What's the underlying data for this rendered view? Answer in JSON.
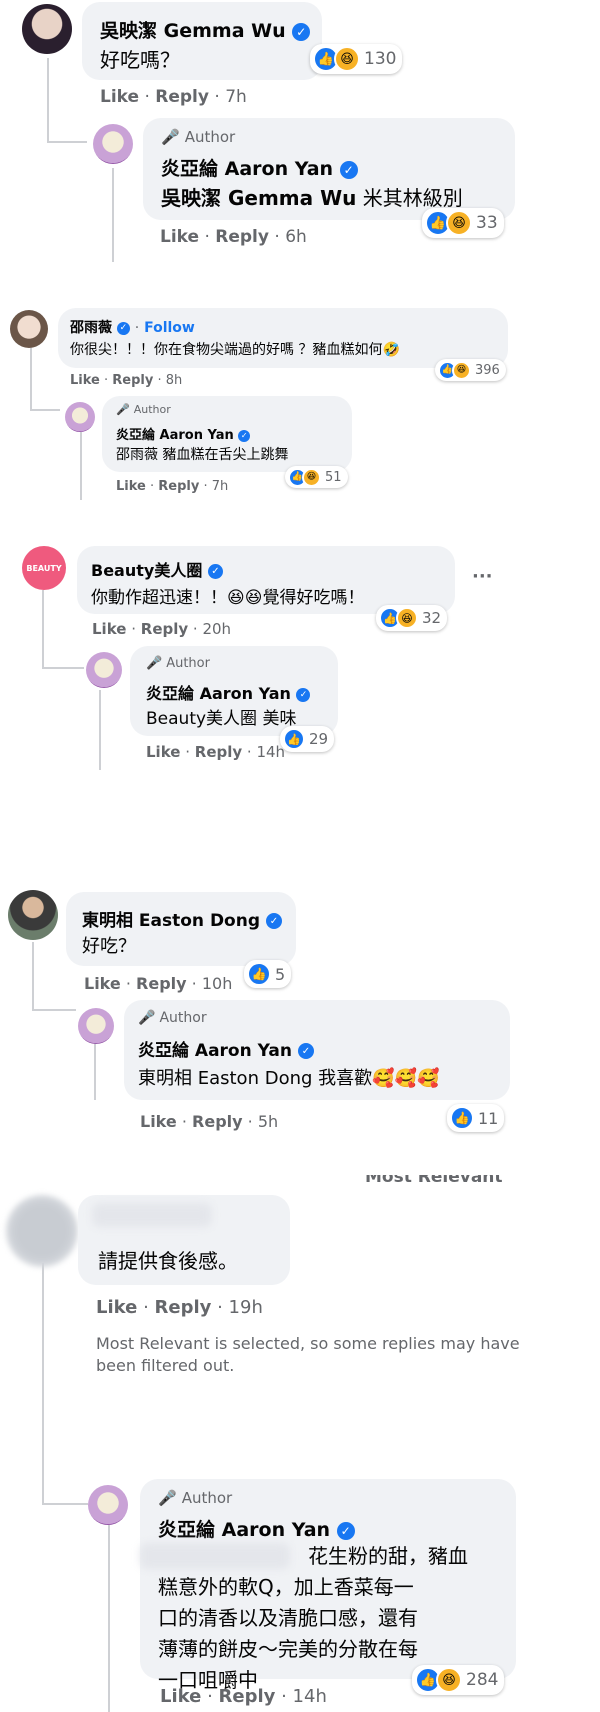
{
  "comments": [
    {
      "name": "吳映潔 Gemma Wu",
      "text": "好吃嗎？",
      "reaction_count": "130",
      "like_label": "Like",
      "reply_label": "Reply",
      "time": "7h",
      "reply": {
        "author_label": "Author",
        "name": "炎亞綸 Aaron Yan",
        "mention": "吳映潔 Gemma Wu",
        "text": "米其林級別",
        "reaction_count": "33",
        "like_label": "Like",
        "reply_label": "Reply",
        "time": "6h"
      }
    },
    {
      "name": "邵雨薇",
      "follow_label": "Follow",
      "text": "你很尖！！！你在食物尖端過的好嗎 ？豬血糕如何🤣",
      "reaction_count": "396",
      "like_label": "Like",
      "reply_label": "Reply",
      "time": "8h",
      "reply": {
        "author_label": "Author",
        "name": "炎亞綸 Aaron Yan",
        "mention": "邵雨薇",
        "text": "豬血糕在舌尖上跳舞",
        "reaction_count": "51",
        "like_label": "Like",
        "reply_label": "Reply",
        "time": "7h"
      }
    },
    {
      "name": "Beauty美人圈",
      "avatar_text": "BEAUTY",
      "text": "你動作超迅速！！😆😆覺得好吃嗎！",
      "reaction_count": "32",
      "like_label": "Like",
      "reply_label": "Reply",
      "time": "20h",
      "more_label": "···",
      "reply": {
        "author_label": "Author",
        "name": "炎亞綸 Aaron Yan",
        "mention": "Beauty美人圈",
        "text": "美味",
        "reaction_count": "29",
        "like_label": "Like",
        "reply_label": "Reply",
        "time": "14h"
      }
    },
    {
      "name": "東明相 Easton Dong",
      "text": "好吃？",
      "reaction_count": "5",
      "like_label": "Like",
      "reply_label": "Reply",
      "time": "10h",
      "reply": {
        "author_label": "Author",
        "name": "炎亞綸 Aaron Yan",
        "mention": "東明相 Easton Dong",
        "text": "我喜歡🥰🥰🥰",
        "reaction_count": "11",
        "like_label": "Like",
        "reply_label": "Reply",
        "time": "5h"
      }
    },
    {
      "header_partial": "Most Relevant",
      "text": "請提供食後感。",
      "like_label": "Like",
      "reply_label": "Reply",
      "time": "19h",
      "filter_notice_line1": "Most Relevant is selected, so some replies may have",
      "filter_notice_line2": "been filtered out.",
      "reply": {
        "author_label": "Author",
        "name": "炎亞綸 Aaron Yan",
        "lines": [
          "花生粉的甜，豬血",
          "糕意外的軟Q，加上香菜每一",
          "口的清香以及清脆口感，還有",
          "薄薄的餅皮～完美的分散在每",
          "一口咀嚼中"
        ],
        "reaction_count": "284",
        "like_label": "Like",
        "reply_label": "Reply",
        "time": "14h"
      }
    }
  ],
  "colors": {
    "accent": "#1877f2",
    "bubble": "#f0f2f5",
    "muted": "#65676b",
    "haha": "#f7b125"
  }
}
